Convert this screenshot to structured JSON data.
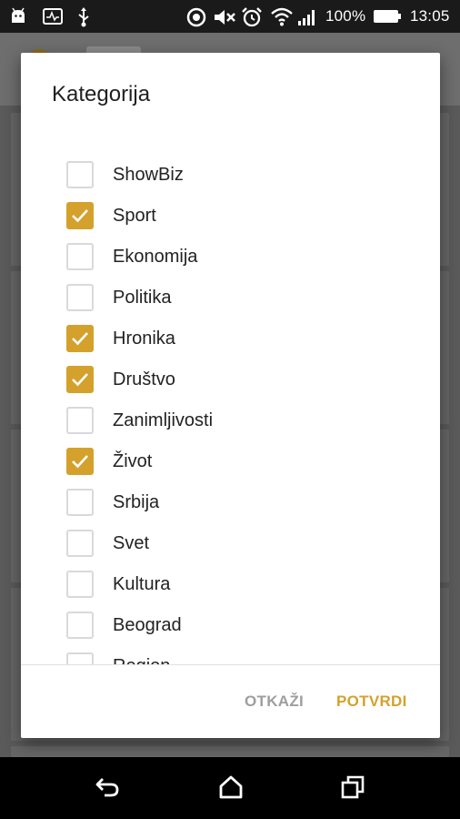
{
  "status_bar": {
    "battery_percent": "100%",
    "time": "13:05",
    "icons": [
      "android-icon",
      "activity-icon",
      "usb-icon",
      "target-icon",
      "mute-icon",
      "alarm-icon",
      "wifi-icon",
      "signal-icon",
      "battery-icon"
    ]
  },
  "dialog": {
    "title": "Kategorija",
    "items": [
      {
        "label": "ShowBiz",
        "checked": false
      },
      {
        "label": "Sport",
        "checked": true
      },
      {
        "label": "Ekonomija",
        "checked": false
      },
      {
        "label": "Politika",
        "checked": false
      },
      {
        "label": "Hronika",
        "checked": true
      },
      {
        "label": "Društvo",
        "checked": true
      },
      {
        "label": "Zanimljivosti",
        "checked": false
      },
      {
        "label": "Život",
        "checked": true
      },
      {
        "label": "Srbija",
        "checked": false
      },
      {
        "label": "Svet",
        "checked": false
      },
      {
        "label": "Kultura",
        "checked": false
      },
      {
        "label": "Beograd",
        "checked": false
      },
      {
        "label": "Region",
        "checked": false
      }
    ],
    "cancel_label": "OTKAŽI",
    "confirm_label": "POTVRDI"
  },
  "colors": {
    "accent": "#D4A12C",
    "checkbox_border": "#D9D9D9",
    "cancel_text": "#9E9E9E",
    "title_text": "#212121"
  },
  "nav_bar": {
    "icons": [
      "back-icon",
      "home-icon",
      "recents-icon"
    ]
  }
}
